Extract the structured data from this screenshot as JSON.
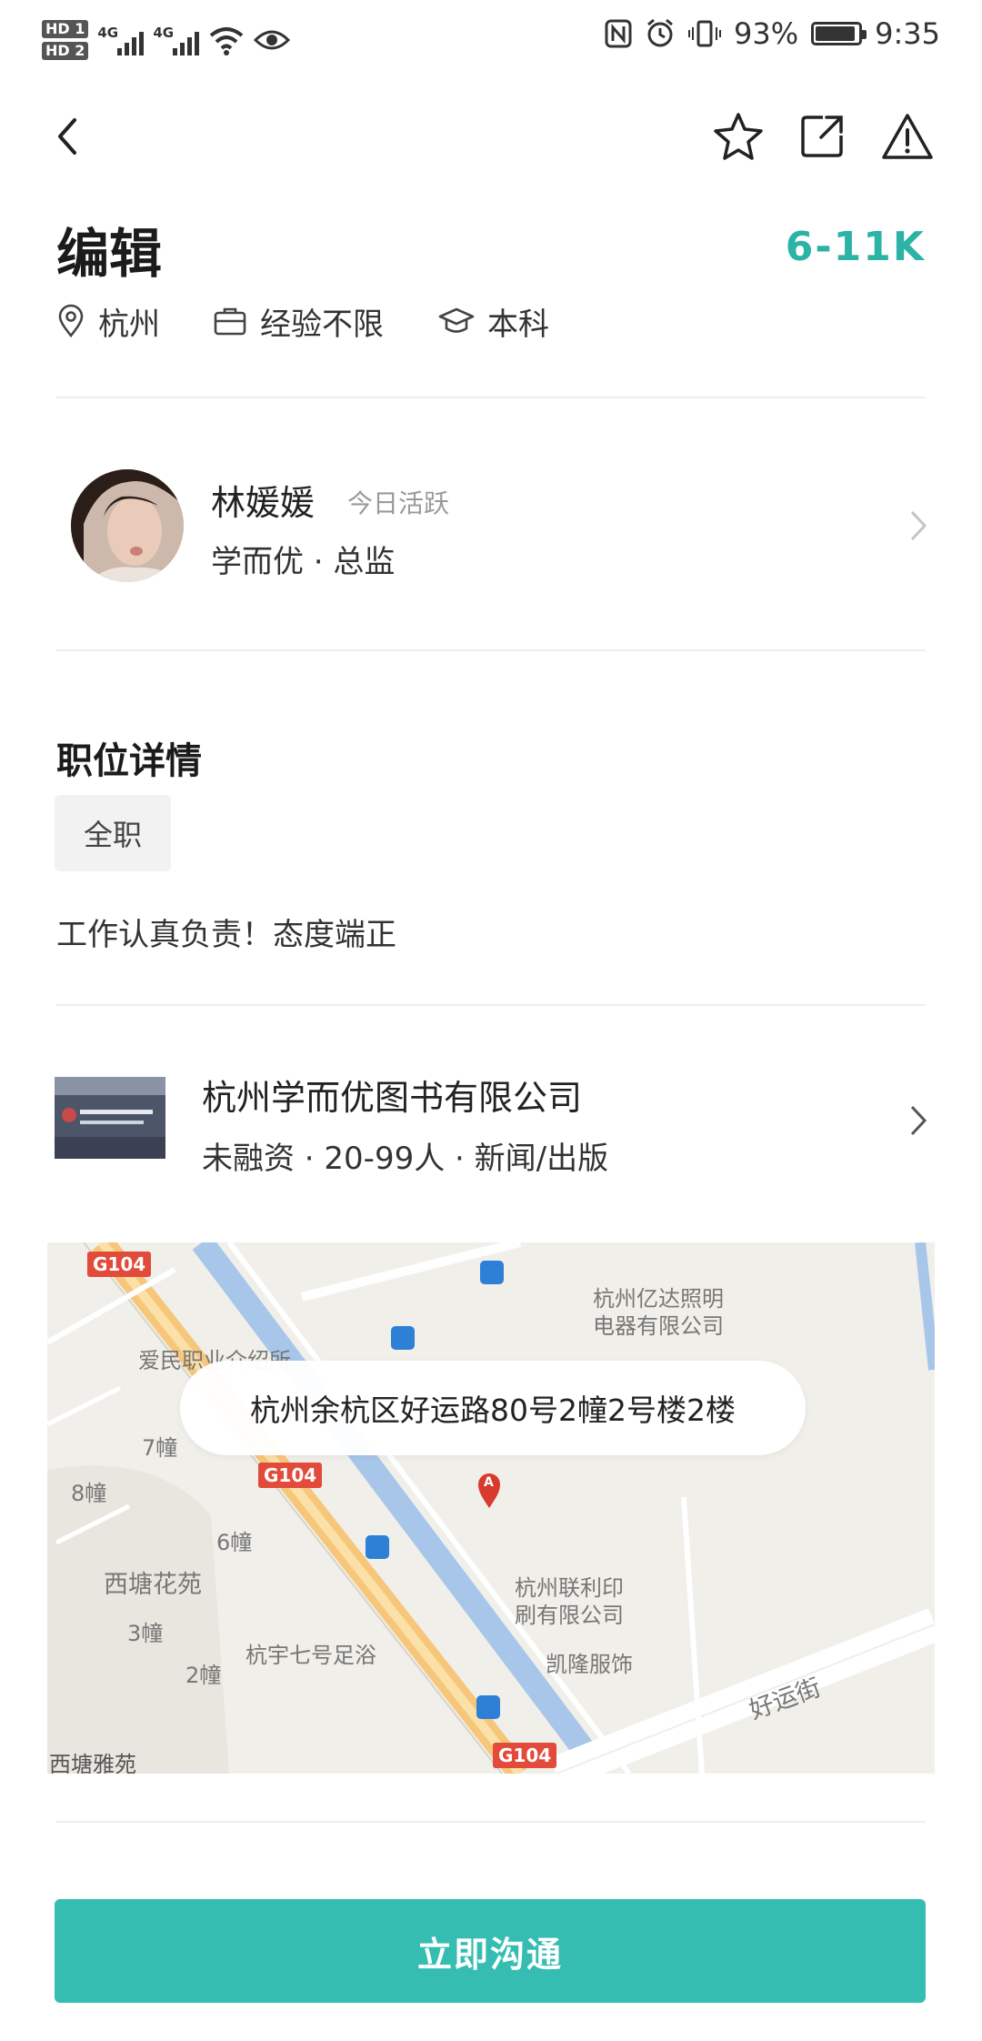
{
  "status_bar": {
    "hd1": "HD 1",
    "hd2": "HD 2",
    "net1": "4G",
    "net2": "4G",
    "battery_percent": "93%",
    "battery_level": 0.93,
    "time": "9:35"
  },
  "job": {
    "title": "编辑",
    "salary": "6-11K",
    "city": "杭州",
    "experience": "经验不限",
    "education": "本科"
  },
  "recruiter": {
    "name": "林媛媛",
    "active": "今日活跃",
    "company_role": "学而优 · 总监"
  },
  "details": {
    "section_title": "职位详情",
    "tag": "全职",
    "description": "工作认真负责！态度端正"
  },
  "company": {
    "name": "杭州学而优图书有限公司",
    "info": "未融资 · 20-99人 · 新闻/出版"
  },
  "map": {
    "address": "杭州余杭区好运路80号2幢2号楼2楼",
    "labels": {
      "g104_1": "G104",
      "g104_2": "G104",
      "g104_3": "G104",
      "yida": "杭州亿达照明",
      "yida2": "电器有限公司",
      "aimin": "爱民职业介绍所",
      "b7": "7幢",
      "b8": "8幢",
      "b6": "6幢",
      "xitang": "西塘花苑",
      "b3": "3幢",
      "b2": "2幢",
      "hangyu": "杭宇七号足浴",
      "lianli": "杭州联利印",
      "lianli2": "刷有限公司",
      "kailong": "凯隆服饰",
      "haoyun": "好运街",
      "yayuan": "西塘雅苑",
      "marker": "A"
    }
  },
  "cta": {
    "label": "立即沟通"
  },
  "colors": {
    "accent": "#2bb3a6",
    "cta": "#36bdb2"
  },
  "icons": [
    "back-icon",
    "star-icon",
    "share-icon",
    "report-icon",
    "location-icon",
    "briefcase-icon",
    "graduation-icon",
    "chevron-right-icon"
  ]
}
